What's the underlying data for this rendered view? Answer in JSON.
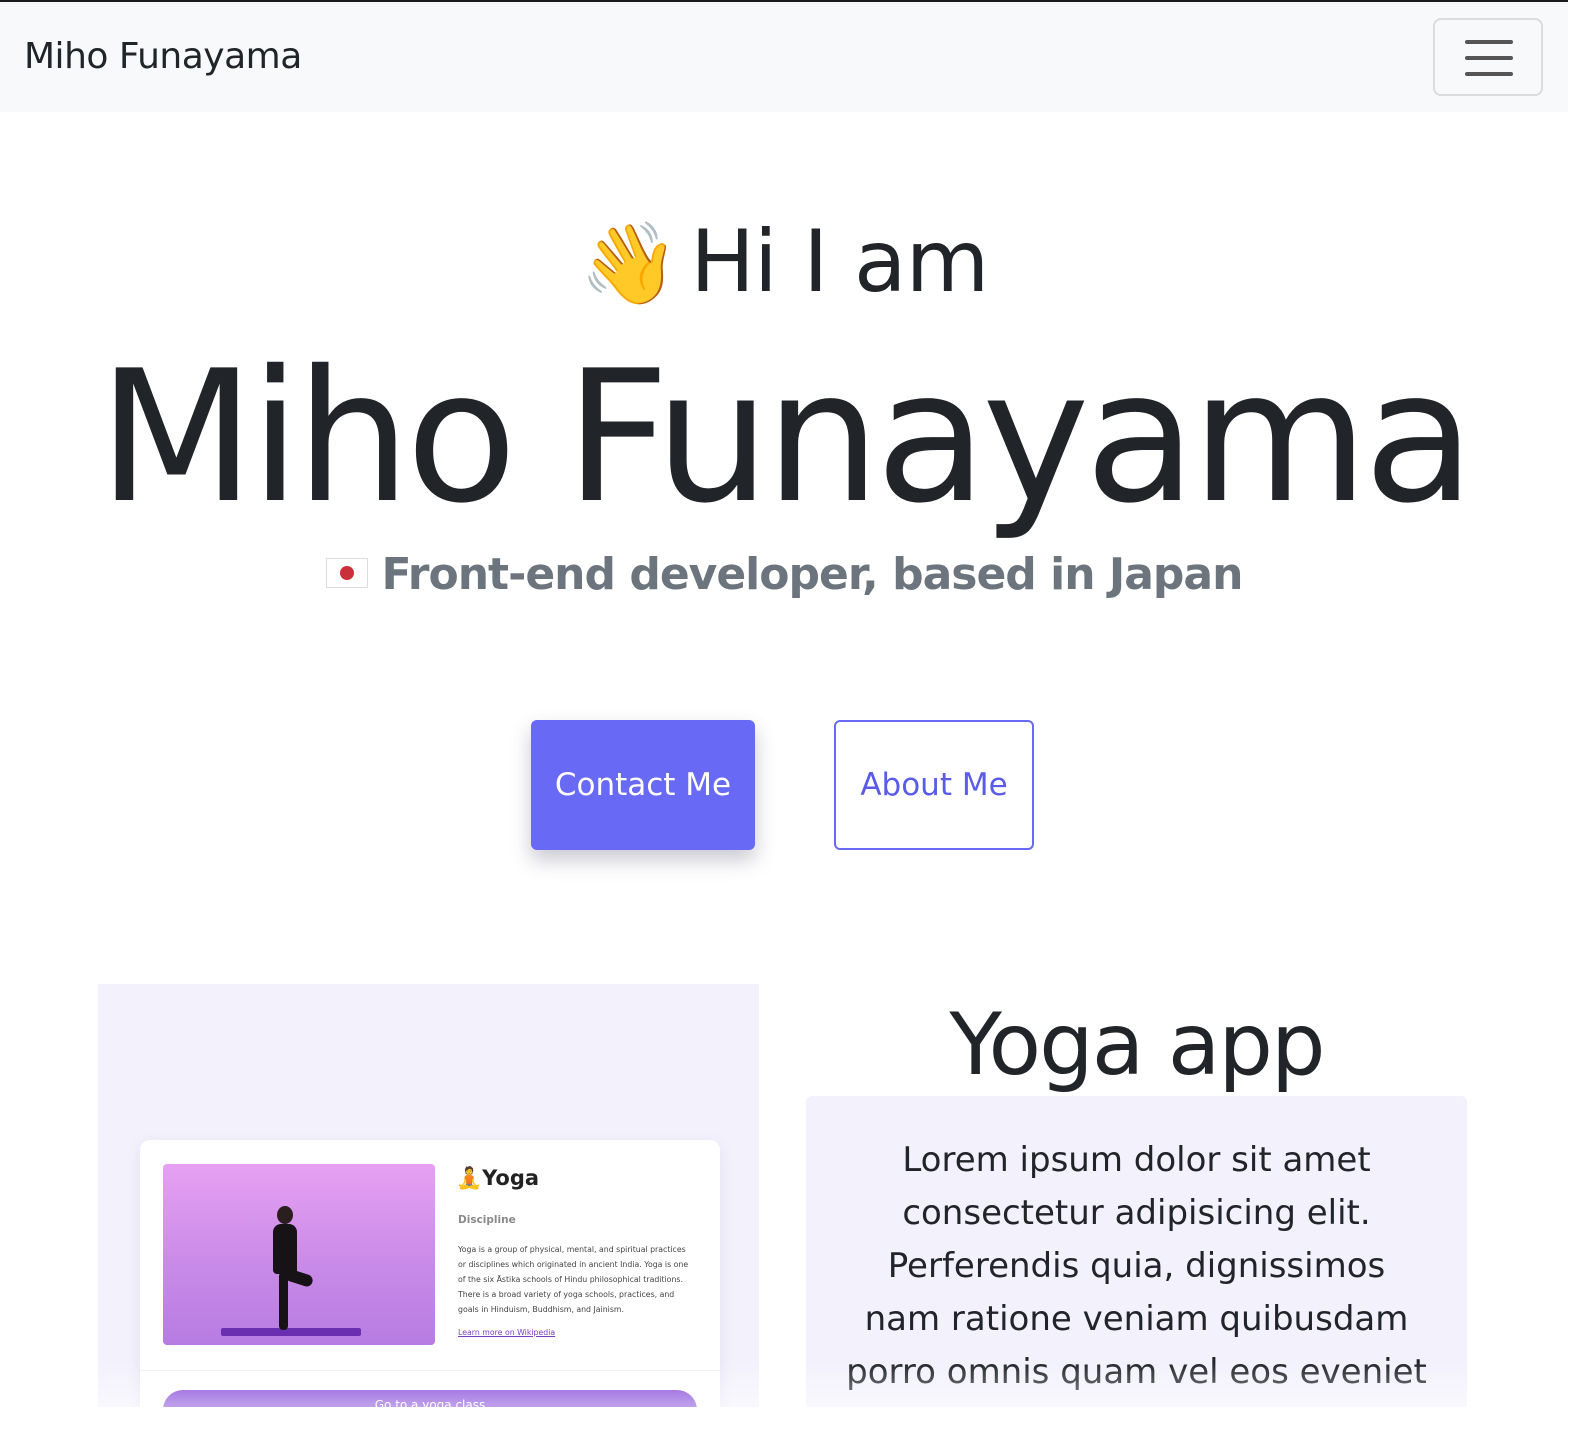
{
  "navbar": {
    "brand": "Miho Funayama",
    "toggle_icon": "hamburger-icon"
  },
  "hero": {
    "greeting_emoji": "👋",
    "greeting": "Hi I am",
    "name": "Miho Funayama",
    "flag_icon": "japan-flag-icon",
    "subtitle": "Front-end developer, based in Japan",
    "contact_button": "Contact Me",
    "about_button": "About Me"
  },
  "project": {
    "title": "Yoga app",
    "description": "Lorem ipsum dolor sit amet consectetur adipisicing elit. Perferendis quia, dignissimos nam ratione veniam quibusdam porro omnis quam vel eos eveniet alias",
    "screenshot": {
      "title_emoji": "🧘",
      "title": "Yoga",
      "label": "Discipline",
      "text": "Yoga is a group of physical, mental, and spiritual practices or disciplines which originated in ancient India. Yoga is one of the six Āstika schools of Hindu philosophical traditions. There is a broad variety of yoga schools, practices, and goals in Hinduism, Buddhism, and Jainism.",
      "link": "Learn more on Wikipedia",
      "button": "Go to a yoga class"
    }
  },
  "colors": {
    "accent": "#6869f5",
    "navbar_bg": "#f8f9fa",
    "panel_bg": "#f3f1fc",
    "muted_text": "#6c757d"
  }
}
